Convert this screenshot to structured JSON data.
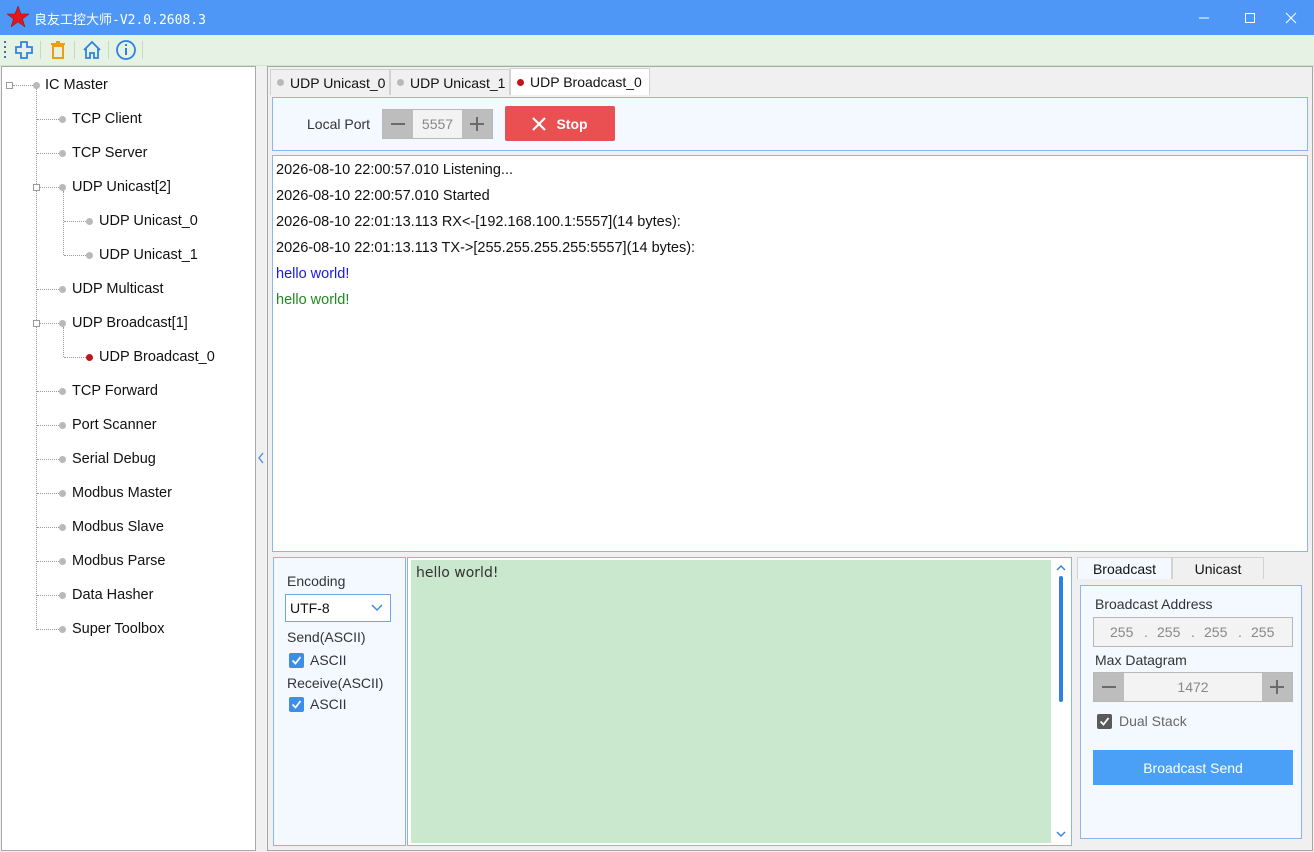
{
  "window": {
    "title": "良友工控大师-V2.0.2608.3",
    "minimize_icon": "minimize-icon",
    "maximize_icon": "maximize-icon",
    "close_icon": "close-icon"
  },
  "toolbar": {
    "items": [
      {
        "name": "add-icon",
        "color": "#2f80e6"
      },
      {
        "name": "delete-icon",
        "color": "#f09a1a"
      },
      {
        "name": "home-icon",
        "color": "#2f80e6"
      },
      {
        "name": "info-icon",
        "color": "#2f80e6"
      }
    ]
  },
  "tree": {
    "root": "IC Master",
    "items": [
      {
        "label": "TCP Client"
      },
      {
        "label": "TCP Server"
      },
      {
        "label": "UDP Unicast[2]"
      },
      {
        "label": "UDP Unicast_0"
      },
      {
        "label": "UDP Unicast_1"
      },
      {
        "label": "UDP Multicast"
      },
      {
        "label": "UDP Broadcast[1]"
      },
      {
        "label": "UDP Broadcast_0"
      },
      {
        "label": "TCP Forward"
      },
      {
        "label": "Port Scanner"
      },
      {
        "label": "Serial Debug"
      },
      {
        "label": "Modbus Master"
      },
      {
        "label": "Modbus Slave"
      },
      {
        "label": "Modbus Parse"
      },
      {
        "label": "Data Hasher"
      },
      {
        "label": "Super Toolbox"
      }
    ]
  },
  "tabs": [
    {
      "label": "UDP Unicast_0"
    },
    {
      "label": "UDP Unicast_1"
    },
    {
      "label": "UDP Broadcast_0"
    }
  ],
  "controls": {
    "local_port_label": "Local Port",
    "local_port_value": "5557",
    "stop_label": "Stop"
  },
  "log": {
    "lines": [
      {
        "text": "2026-08-10 22:00:57.010 Listening...",
        "color": "#111111"
      },
      {
        "text": "2026-08-10 22:00:57.010 Started",
        "color": "#111111"
      },
      {
        "text": "2026-08-10 22:01:13.113 RX<-[192.168.100.1:5557](14 bytes):",
        "color": "#111111"
      },
      {
        "text": "2026-08-10 22:01:13.113 TX->[255.255.255.255:5557](14 bytes):",
        "color": "#111111"
      },
      {
        "text": "hello world!",
        "color": "#1a1adc"
      },
      {
        "text": "hello world!",
        "color": "#1f8a1f"
      }
    ]
  },
  "send_options": {
    "encoding_label": "Encoding",
    "encoding_value": "UTF-8",
    "send_label": "Send(ASCII)",
    "send_checkbox_label": "ASCII",
    "receive_label": "Receive(ASCII)",
    "receive_checkbox_label": "ASCII"
  },
  "send_area": {
    "text": "hello world!"
  },
  "right_tabs": [
    {
      "label": "Broadcast"
    },
    {
      "label": "Unicast"
    }
  ],
  "broadcast": {
    "address_label": "Broadcast Address",
    "address": [
      "255",
      "255",
      "255",
      "255"
    ],
    "max_datagram_label": "Max Datagram",
    "max_datagram_value": "1472",
    "dual_stack_label": "Dual Stack",
    "send_button": "Broadcast Send"
  },
  "colors": {
    "titlebar": "#4f97f6",
    "accent": "#2f80e6",
    "stop": "#ea4f52",
    "send_area": "#c9e8cd",
    "active_dot": "#c4141b"
  }
}
